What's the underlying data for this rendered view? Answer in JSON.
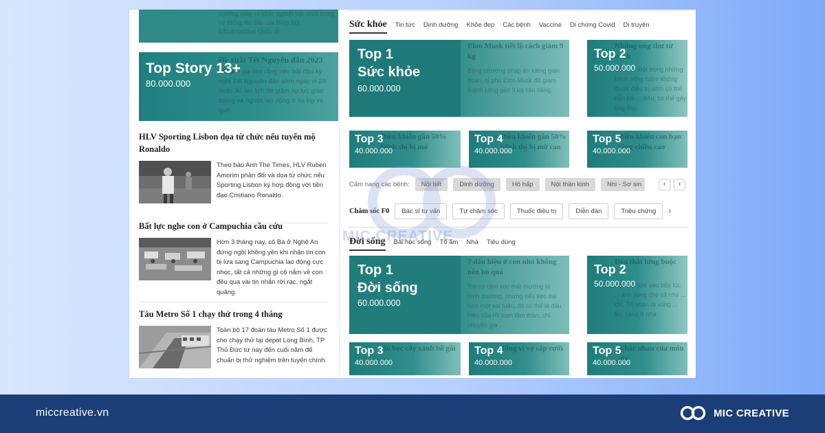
{
  "left": {
    "top_snippet": "thường niên và khắc nghiệt bậc nhất trong hệ thống thi đấu của Hiệp hội Ultratriathlon Quốc tế",
    "story": {
      "ghost_title": "Đề xuất Tết Nguyên đán 2023 sớm",
      "ghost_text": "chuyên gia cho rằng nên bắt đầu kỳ nghỉ Tết Nguyên đán sớm ngay vì 29 hoặc 30 âm lịch để giảm áp lực giao thông và người lao động ở xa kịp về quê.",
      "tag_title": "Top Story 13+",
      "tag_value": "80.000.000"
    },
    "news": [
      {
        "title": "HLV Sporting Lisbon dọa từ chức nếu tuyển mộ Ronaldo",
        "text": "Theo báo Anh The Times, HLV Ruben Amorim phản đối và dọa từ chức nếu Sporting Lisbon ký hợp đồng với tiền đạo Cristiano Ronaldo."
      },
      {
        "title": "Bất lực nghe con ở Campuchia cầu cứu",
        "text": "Hơn 3 tháng nay, cô Ba ở Nghệ An đứng ngồi không yên khi nhận tin con bị lừa sang Campuchia lao động cực nhọc, tất cả những gì cô nắm về con đều qua vài tin nhắn rời rạc, ngắt quãng."
      },
      {
        "title": "Tàu Metro Số 1 chạy thử trong 4 tháng",
        "text": "Toàn bộ 17 đoàn tàu Metro Số 1 được cho chạy thử tại depot Long Bình, TP Thủ Đức từ nay đến cuối năm để chuẩn bị thử nghiệm trên tuyến chính."
      }
    ]
  },
  "suckhoe": {
    "title": "Sức khỏe",
    "tabs": [
      "Tin tức",
      "Dinh dưỡng",
      "Khỏe đẹp",
      "Các bệnh",
      "Vaccine",
      "Di chứng Covid",
      "Di truyền"
    ],
    "top1": {
      "rank": "Top 1",
      "label": "Sức khỏe",
      "value": "60.000.000",
      "ghost_title": "Elon Musk tiết lộ cách giảm 9 kg",
      "ghost_text": "Bằng phương pháp ăn kiêng gián đoạn, tỷ phú Elon Musk đã giảm thành công gần 9 kg cân nặng."
    },
    "top2": {
      "rank": "Top 2",
      "value": "50.000.000",
      "ghost_title": "Những ung thư từ bệnh",
      "ghost_text": "Bệnh là một trong những bệnh sống hiểm không được điều trị sớm có thể dẫn tới ... điều, có thể gây ung thư."
    },
    "small": [
      {
        "rank": "Top 3",
        "value": "40.000.000",
        "ghost": "Điều khiến gần 50% bệnh thị bị mờ"
      },
      {
        "rank": "Top 4",
        "value": "40.000.000",
        "ghost": "Điều khiến gần 50% bệnh thị bị mờ cao"
      },
      {
        "rank": "Top 5",
        "value": "40.000.000",
        "ghost": "Điều khiến con bạn tăng chiều cao"
      }
    ],
    "handbook_label": "Cẩm nang các bệnh:",
    "handbook_chips": [
      "Nội tiết",
      "Dinh dưỡng",
      "Hô hấp",
      "Nội thần kinh",
      "Nhi - Sơ sin"
    ],
    "f0_label": "Chăm sóc F0",
    "f0_buttons": [
      "Bác sĩ tư vấn",
      "Tự chăm sóc",
      "Thuốc điều trị",
      "Diễn đàn",
      "Triệu chứng"
    ]
  },
  "doisong": {
    "title": "Đời sống",
    "tabs": [
      "Bài học sống",
      "Tổ ấm",
      "Nhà",
      "Tiêu dùng"
    ],
    "top1": {
      "rank": "Top 1",
      "label": "Đời sống",
      "value": "60.000.000",
      "ghost_title": "7 dấu hiệu ở con nhỏ không nên bỏ qua",
      "ghost_text": "Trẻ có cảm xúc thất thường là bình thường, nhưng nếu kéo dài hơn một vài tuần, đó có thể là dấu hiệu của rối loạn tâm thần, chỉ chuyên gia ..."
    },
    "top2": {
      "rank": "Top 2",
      "value": "50.000.000",
      "ghost_title": "Đèn thắt lưng buộc",
      "ghost_text": "Khi mỗi sức vào bếp lúc ... ánh sáng cho cả nhà ... chỉ, Tô nhận ra vùng ... ăn, sáng ở nhà"
    },
    "small": [
      {
        "rank": "Top 3",
        "value": "40.000.000",
        "ghost": "Đồ bọc cây xanh bổ gái"
      },
      {
        "rank": "Top 4",
        "value": "40.000.000",
        "ghost": "Sống vì vợ sắp cưới"
      },
      {
        "rank": "Top 5",
        "value": "40.000.000",
        "ghost": "Khác nhau của món giả"
      }
    ]
  },
  "watermark": {
    "text": "MIC CREATIVE"
  },
  "footer": {
    "site": "miccreative.vn",
    "brand": "MIC CREATIVE"
  }
}
